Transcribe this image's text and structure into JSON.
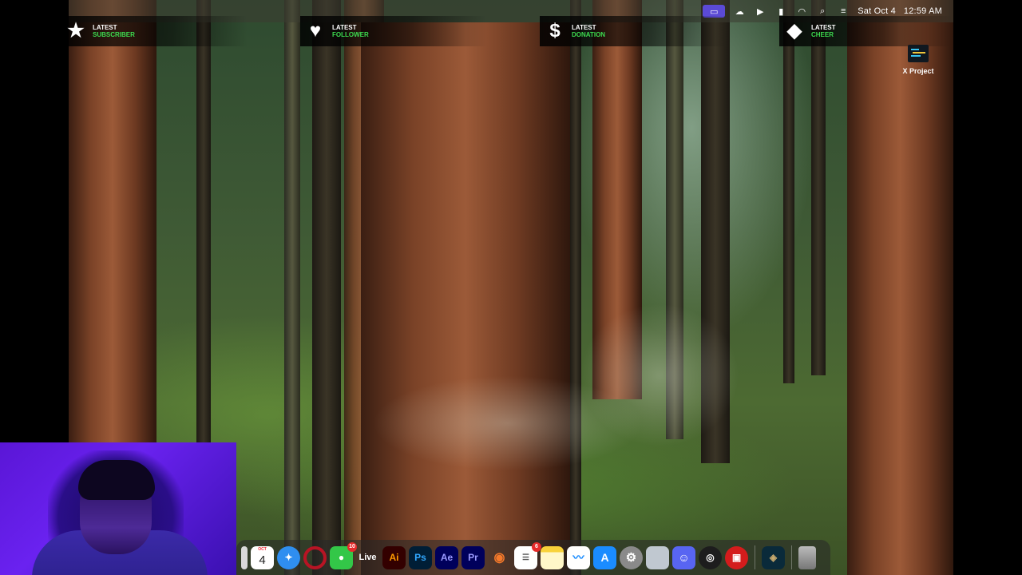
{
  "menubar": {
    "apple_glyph": "",
    "date": "Sat Oct 4",
    "time": "12:59 AM",
    "icons": [
      "screen-record-icon",
      "creative-cloud-icon",
      "play-icon",
      "battery-icon",
      "wifi-icon",
      "search-icon",
      "control-center-icon"
    ]
  },
  "alerts": [
    {
      "top": "LATEST",
      "bottom": "SUBSCRIBER",
      "icon": "star-icon",
      "glyph": "★"
    },
    {
      "top": "LATEST",
      "bottom": "FOLLOWER",
      "icon": "heart-icon",
      "glyph": "♥"
    },
    {
      "top": "LATEST",
      "bottom": "DONATION",
      "icon": "dollar-icon",
      "glyph": "$"
    },
    {
      "top": "LATEST",
      "bottom": "CHEER",
      "icon": "diamond-icon",
      "glyph": "◆"
    }
  ],
  "desktop_item": {
    "label": "X Project"
  },
  "dock": {
    "calendar": {
      "month": "OCT",
      "day": "4"
    },
    "messages_badge": "10",
    "live_label": "Live",
    "reminders_badge": "6",
    "apps": [
      {
        "name": "launchpad-icon",
        "label": "",
        "color": "#d9d9d9"
      },
      {
        "name": "calendar-icon",
        "label": "",
        "color": "#ffffff"
      },
      {
        "name": "safari-icon",
        "label": "",
        "color": "#2f8ef0"
      },
      {
        "name": "opera-icon",
        "label": "",
        "color": "#b81424"
      },
      {
        "name": "messages-icon",
        "label": "",
        "color": "#33c748"
      },
      {
        "name": "live-icon",
        "label": "",
        "color": "transparent"
      },
      {
        "name": "illustrator-icon",
        "label": "Ai",
        "color": "#330000"
      },
      {
        "name": "photoshop-icon",
        "label": "Ps",
        "color": "#001e36"
      },
      {
        "name": "after-effects-icon",
        "label": "Ae",
        "color": "#00005b"
      },
      {
        "name": "premiere-icon",
        "label": "Pr",
        "color": "#00005b"
      },
      {
        "name": "blender-icon",
        "label": "",
        "color": "#2a2a2a"
      },
      {
        "name": "reminders-icon",
        "label": "",
        "color": "#ffffff"
      },
      {
        "name": "notes-icon",
        "label": "",
        "color": "#fff3b0"
      },
      {
        "name": "freeform-icon",
        "label": "",
        "color": "#ffffff"
      },
      {
        "name": "app-store-icon",
        "label": "",
        "color": "#1a8cff"
      },
      {
        "name": "system-settings-icon",
        "label": "",
        "color": "#8a8a8a"
      },
      {
        "name": "finder-window-icon",
        "label": "",
        "color": "#c0c8d0"
      },
      {
        "name": "discord-icon",
        "label": "",
        "color": "#5865f2"
      },
      {
        "name": "obs-icon",
        "label": "",
        "color": "#1d1d1d"
      },
      {
        "name": "game-launcher-icon",
        "label": "",
        "color": "#d41c1c"
      },
      {
        "name": "league-icon",
        "label": "",
        "color": "#0a2a3a"
      },
      {
        "name": "trash-icon",
        "label": "",
        "color": "#9a9a9a"
      }
    ]
  }
}
